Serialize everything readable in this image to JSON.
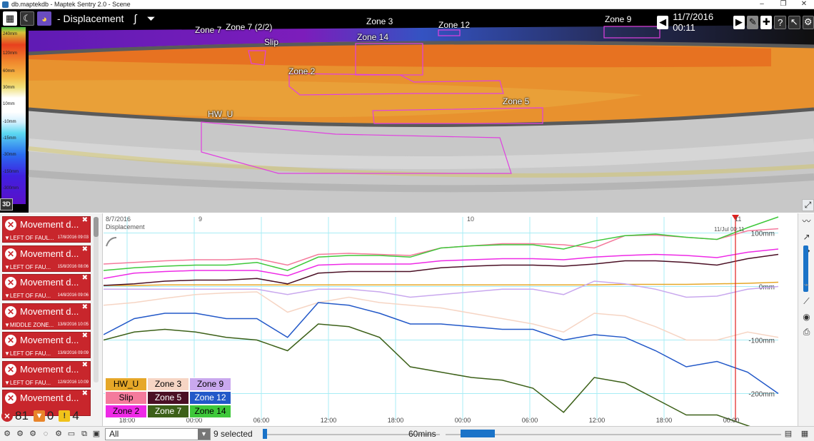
{
  "window": {
    "title": "db.maptekdb - Maptek Sentry 2.0 - Scene",
    "controls": [
      "–",
      "❐",
      "✕"
    ]
  },
  "scene": {
    "title": "- Displacement",
    "datetime": "11/7/2016 00:11",
    "legend_labels": [
      "240mm",
      "120mm",
      "60mm",
      "30mm",
      "10mm",
      "-10mm",
      "-15mm",
      "-30mm",
      "-150mm",
      "-300mm"
    ],
    "zone_labels": [
      "Zone 7",
      "Zone 7 (2/2)",
      "Zone 3",
      "Zone 12",
      "Zone 9",
      "Zone 14",
      "Slip",
      "Zone 2",
      "Zone 5",
      "HW_U"
    ],
    "mode_label": "3D"
  },
  "alerts": [
    {
      "title": "Movement d...",
      "sub": "LEFT OF FAUL...",
      "date": "17/8/2016 09:03"
    },
    {
      "title": "Movement d...",
      "sub": "LEFT OF FAU...",
      "date": "15/8/2016 08:06"
    },
    {
      "title": "Movement d...",
      "sub": "LEFT OF FAU...",
      "date": "14/8/2016 09:06"
    },
    {
      "title": "Movement d...",
      "sub": "MIDDLE ZONE...",
      "date": "13/8/2016 10:05"
    },
    {
      "title": "Movement d...",
      "sub": "LEFT OF FAU...",
      "date": "13/8/2016 09:09"
    },
    {
      "title": "Movement d...",
      "sub": "LEFT OF FAU...",
      "date": "12/8/2016 10:09"
    },
    {
      "title": "Movement d...",
      "sub": "",
      "date": ""
    }
  ],
  "counts": {
    "critical": "81",
    "warning": "0",
    "caution": "4"
  },
  "chart": {
    "date_label": "8/7/2016",
    "series_title": "Displacement",
    "day_labels": [
      "9",
      "10",
      "11"
    ],
    "cursor_label": "11/Jul 00:11",
    "y_labels": [
      "100mm",
      "0mm",
      "-100mm",
      "-200mm"
    ],
    "x_labels": [
      "18:00",
      "00:00",
      "06:00",
      "12:00",
      "18:00",
      "00:00",
      "06:00",
      "12:00",
      "18:00",
      "00:00"
    ],
    "legend": [
      {
        "name": "HW_U",
        "color": "#e6a728"
      },
      {
        "name": "Zone 3",
        "color": "#f6d5c4"
      },
      {
        "name": "Zone 9",
        "color": "#c9a8ee"
      },
      {
        "name": "Slip",
        "color": "#f47a9c"
      },
      {
        "name": "Zone 5",
        "color": "#4a0f24"
      },
      {
        "name": "Zone 12",
        "color": "#2258c8"
      },
      {
        "name": "Zone 2",
        "color": "#ee2ae6"
      },
      {
        "name": "Zone 7",
        "color": "#3c6018"
      },
      {
        "name": "Zone 14",
        "color": "#3ec83a"
      }
    ]
  },
  "chart_data": {
    "type": "line",
    "title": "Displacement",
    "ylabel": "",
    "xlabel": "",
    "ylim": [
      -250,
      130
    ],
    "x": [
      "8/7 15:00",
      "8/7 18:00",
      "8/7 21:00",
      "9/7 00:00",
      "9/7 03:00",
      "9/7 06:00",
      "9/7 08:00",
      "9/7 09:00",
      "9/7 12:00",
      "9/7 15:00",
      "9/7 18:00",
      "9/7 21:00",
      "10/7 00:00",
      "10/7 03:00",
      "10/7 06:00",
      "10/7 08:00",
      "10/7 09:00",
      "10/7 12:00",
      "10/7 15:00",
      "10/7 18:00",
      "10/7 19:00",
      "10/7 21:00",
      "11/7 00:00"
    ],
    "series": [
      {
        "name": "HW_U",
        "values": [
          2,
          2,
          3,
          3,
          3,
          3,
          3,
          3,
          3,
          3,
          3,
          3,
          3,
          3,
          3,
          3,
          3,
          4,
          4,
          4,
          5,
          6,
          8
        ]
      },
      {
        "name": "Zone 3",
        "values": [
          -35,
          -30,
          -22,
          -15,
          -12,
          -10,
          -48,
          -30,
          -20,
          -30,
          -35,
          -40,
          -50,
          -60,
          -70,
          -85,
          -50,
          -55,
          -75,
          -100,
          -100,
          -85,
          -95
        ]
      },
      {
        "name": "Zone 9",
        "values": [
          -5,
          -5,
          -5,
          -5,
          -5,
          -5,
          -15,
          -5,
          -5,
          -10,
          -20,
          -15,
          -10,
          -5,
          -5,
          -15,
          10,
          5,
          -5,
          -20,
          -18,
          -5,
          0
        ]
      },
      {
        "name": "Slip",
        "values": [
          42,
          45,
          48,
          50,
          50,
          52,
          40,
          60,
          62,
          60,
          58,
          72,
          76,
          80,
          80,
          78,
          72,
          95,
          96,
          92,
          88,
          104,
          108
        ]
      },
      {
        "name": "Zone 5",
        "values": [
          2,
          5,
          10,
          12,
          12,
          15,
          5,
          25,
          28,
          28,
          28,
          35,
          38,
          40,
          40,
          38,
          42,
          48,
          48,
          45,
          40,
          52,
          60
        ]
      },
      {
        "name": "Zone 12",
        "values": [
          -90,
          -60,
          -50,
          -50,
          -60,
          -60,
          -95,
          -30,
          -35,
          -50,
          -70,
          -70,
          -75,
          -80,
          -80,
          -100,
          -90,
          -95,
          -120,
          -150,
          -140,
          -160,
          -200
        ]
      },
      {
        "name": "Zone 2",
        "values": [
          15,
          25,
          28,
          30,
          30,
          30,
          20,
          40,
          42,
          42,
          42,
          48,
          50,
          52,
          52,
          50,
          55,
          58,
          60,
          58,
          54,
          64,
          70
        ]
      },
      {
        "name": "Zone 7",
        "values": [
          -100,
          -85,
          -80,
          -85,
          -95,
          -100,
          -120,
          -70,
          -75,
          -95,
          -150,
          -160,
          -170,
          -175,
          -190,
          -235,
          -170,
          -180,
          -210,
          -240,
          -240,
          -260,
          -280
        ]
      },
      {
        "name": "Zone 14",
        "values": [
          30,
          35,
          38,
          40,
          40,
          45,
          30,
          55,
          58,
          58,
          55,
          72,
          76,
          78,
          78,
          70,
          85,
          95,
          98,
          92,
          88,
          110,
          130
        ]
      }
    ]
  },
  "statusbar": {
    "filter": "All",
    "selected": "9 selected",
    "interval": "60mins"
  }
}
